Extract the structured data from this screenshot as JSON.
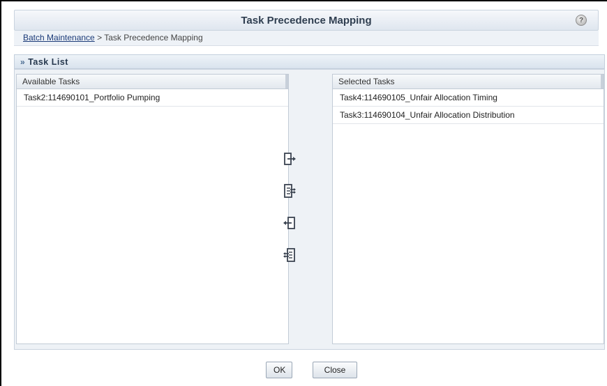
{
  "window": {
    "title": "Task Precedence Mapping",
    "help_icon": "help-icon"
  },
  "breadcrumb": {
    "link": "Batch Maintenance",
    "separator": " > ",
    "current": "Task Precedence Mapping"
  },
  "section": {
    "chevron": "»",
    "title": "Task List"
  },
  "available": {
    "header": "Available Tasks",
    "items": [
      "Task2:114690101_Portfolio Pumping"
    ]
  },
  "selected": {
    "header": "Selected Tasks",
    "items": [
      "Task4:114690105_Unfair Allocation Timing",
      "Task3:114690104_Unfair Allocation Distribution"
    ]
  },
  "shuttle": {
    "icons": [
      "move-selected-right-icon",
      "move-all-right-icon",
      "move-selected-left-icon",
      "move-all-left-icon"
    ]
  },
  "buttons": {
    "ok": "OK",
    "close": "Close"
  }
}
